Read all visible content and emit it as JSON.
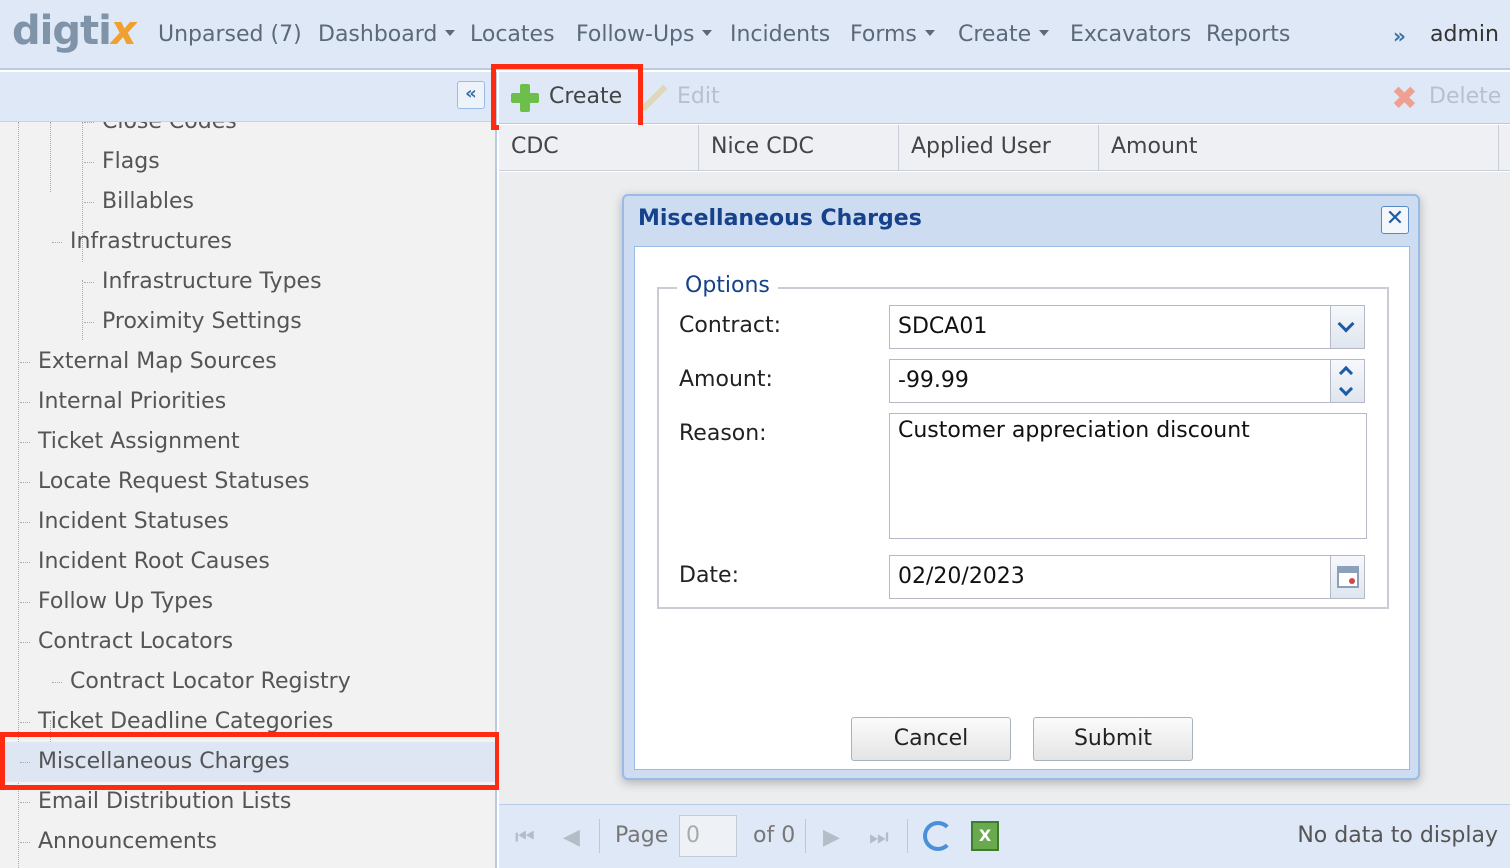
{
  "nav": {
    "logo_main": "digti",
    "logo_accent": "x",
    "items": [
      {
        "label": "Unparsed (7)"
      },
      {
        "label": "Dashboard"
      },
      {
        "label": "Locates"
      },
      {
        "label": "Follow-Ups"
      },
      {
        "label": "Incidents"
      },
      {
        "label": "Forms"
      },
      {
        "label": "Create"
      },
      {
        "label": "Excavators"
      },
      {
        "label": "Reports"
      }
    ],
    "more_icon": "»",
    "user": "admin"
  },
  "sidebar": {
    "collapse_icon": "«",
    "items": [
      {
        "label": "Close Codes"
      },
      {
        "label": "Flags"
      },
      {
        "label": "Billables"
      },
      {
        "label": "Infrastructures"
      },
      {
        "label": "Infrastructure Types"
      },
      {
        "label": "Proximity Settings"
      },
      {
        "label": "External Map Sources"
      },
      {
        "label": "Internal Priorities"
      },
      {
        "label": "Ticket Assignment"
      },
      {
        "label": "Locate Request Statuses"
      },
      {
        "label": "Incident Statuses"
      },
      {
        "label": "Incident Root Causes"
      },
      {
        "label": "Follow Up Types"
      },
      {
        "label": "Contract Locators"
      },
      {
        "label": "Contract Locator Registry"
      },
      {
        "label": "Ticket Deadline Categories"
      },
      {
        "label": "Miscellaneous Charges"
      },
      {
        "label": "Email Distribution Lists"
      },
      {
        "label": "Announcements"
      }
    ]
  },
  "toolbar": {
    "create_label": "Create",
    "edit_label": "Edit",
    "delete_label": "Delete"
  },
  "grid": {
    "columns": [
      "CDC",
      "Nice CDC",
      "Applied User",
      "Amount"
    ]
  },
  "paging": {
    "page_label": "Page",
    "page_value": "0",
    "of_label": "of 0",
    "status": "No data to display",
    "excel_letter": "X"
  },
  "dialog": {
    "title": "Miscellaneous Charges",
    "close_icon": "✕",
    "legend": "Options",
    "contract_label": "Contract:",
    "contract_value": "SDCA01",
    "amount_label": "Amount:",
    "amount_value": "-99.99",
    "reason_label": "Reason:",
    "reason_value": "Customer appreciation discount",
    "date_label": "Date:",
    "date_value": "02/20/2023",
    "cancel_label": "Cancel",
    "submit_label": "Submit"
  },
  "colors": {
    "highlight": "#ff2a12",
    "header_bg": "#dfe8f6",
    "dialog_title": "#15428b"
  }
}
